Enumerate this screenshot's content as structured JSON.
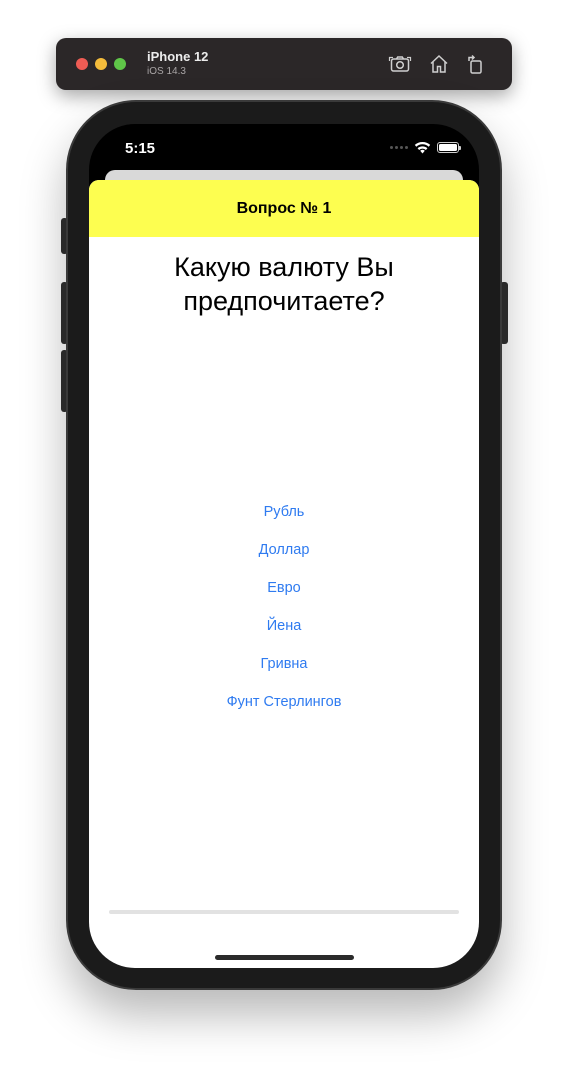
{
  "simulator": {
    "device_name": "iPhone 12",
    "os_version": "iOS 14.3",
    "screenshot_icon": "camera-icon",
    "home_icon": "home-icon",
    "rotate_icon": "rotate-icon"
  },
  "status_bar": {
    "time": "5:15",
    "wifi_icon": "wifi-icon",
    "battery_icon": "battery-icon"
  },
  "nav": {
    "title": "Вопрос № 1",
    "background": "#fdfe50"
  },
  "question": {
    "line1": "Какую валюту Вы",
    "line2": "предпочитаете?"
  },
  "answers": [
    {
      "label": "Рубль"
    },
    {
      "label": "Доллар"
    },
    {
      "label": "Евро"
    },
    {
      "label": "Йена"
    },
    {
      "label": "Гривна"
    },
    {
      "label": "Фунт Стерлингов"
    }
  ],
  "progress": {
    "value": 0.0
  },
  "colors": {
    "accent": "#2f7bf0",
    "nav_bar": "#fdfe50",
    "progress_track": "#e2e2e2"
  }
}
